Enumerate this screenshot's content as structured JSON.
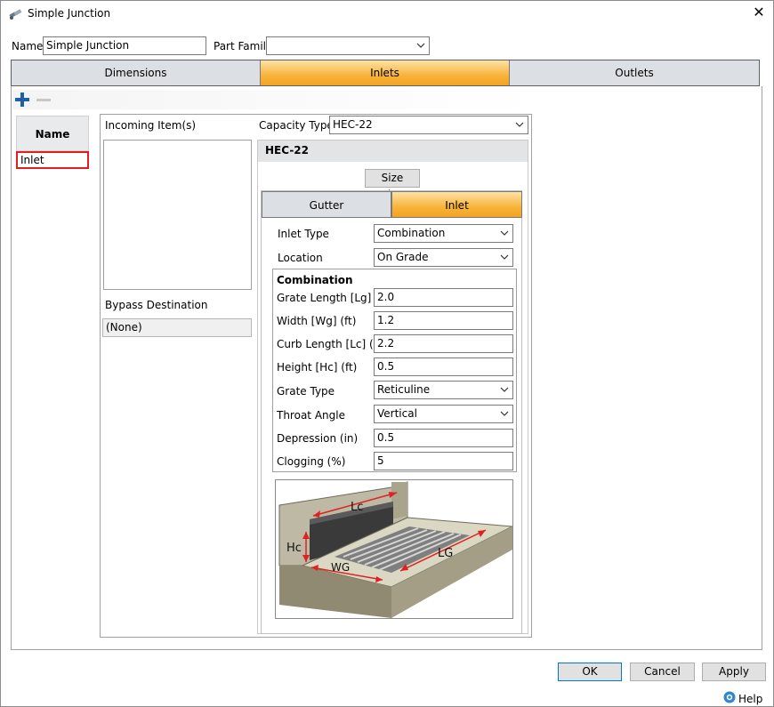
{
  "window": {
    "title": "Simple Junction"
  },
  "header": {
    "name_label": "Name",
    "name_value": "Simple Junction",
    "part_family_label": "Part Family",
    "part_family_value": ""
  },
  "tabs": [
    {
      "label": "Dimensions",
      "active": false
    },
    {
      "label": "Inlets",
      "active": true
    },
    {
      "label": "Outlets",
      "active": false
    }
  ],
  "inlet_list": {
    "header": "Name",
    "items": [
      "Inlet"
    ]
  },
  "incoming": {
    "label": "Incoming Item(s)",
    "bypass_label": "Bypass Destination",
    "bypass_value": "(None)"
  },
  "capacity": {
    "label": "Capacity Type",
    "value": "HEC-22",
    "section_title": "HEC-22",
    "size_button": "Size Inlets"
  },
  "subtabs": [
    {
      "label": "Gutter",
      "active": false
    },
    {
      "label": "Inlet",
      "active": true
    }
  ],
  "inlet_form": {
    "inlet_type_label": "Inlet Type",
    "inlet_type_value": "Combination",
    "location_label": "Location",
    "location_value": "On Grade",
    "group_title": "Combination",
    "fields": [
      {
        "label": "Grate Length [Lg] (ft)",
        "value": "2.0",
        "kind": "text"
      },
      {
        "label": "Width [Wg] (ft)",
        "value": "1.2",
        "kind": "text"
      },
      {
        "label": "Curb Length [Lc] (ft)",
        "value": "2.2",
        "kind": "text"
      },
      {
        "label": "Height [Hc] (ft)",
        "value": "0.5",
        "kind": "text"
      },
      {
        "label": "Grate Type",
        "value": "Reticuline",
        "kind": "combo"
      },
      {
        "label": "Throat Angle",
        "value": "Vertical",
        "kind": "combo"
      },
      {
        "label": "Depression (in)",
        "value": "0.5",
        "kind": "text"
      },
      {
        "label": "Clogging (%)",
        "value": "5",
        "kind": "text"
      }
    ]
  },
  "diagram": {
    "label_lc": "Lc",
    "label_hc": "Hc",
    "label_wg": "WG",
    "label_lg": "LG"
  },
  "footer": {
    "ok": "OK",
    "cancel": "Cancel",
    "apply": "Apply",
    "help": "Help"
  },
  "colors": {
    "active_tab": "#f8b33a",
    "inactive_tab": "#dcdfe3",
    "selected_border": "#e02020",
    "accent_blue": "#1f5fa8"
  }
}
